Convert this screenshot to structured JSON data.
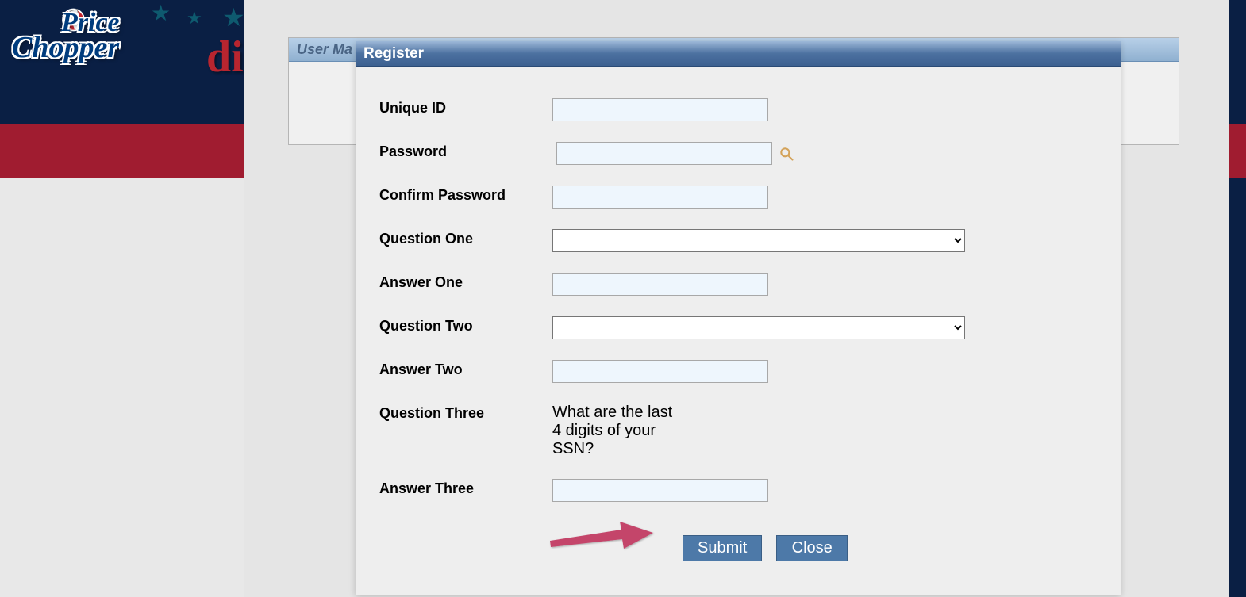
{
  "background": {
    "logo_price": "Price",
    "logo_chopper": "Chopper",
    "logo_partial": "di",
    "user_panel_title": "User Ma"
  },
  "modal": {
    "title": "Register",
    "fields": {
      "unique_id": {
        "label": "Unique ID",
        "value": ""
      },
      "password": {
        "label": "Password",
        "value": ""
      },
      "confirm_password": {
        "label": "Confirm Password",
        "value": ""
      },
      "question_one": {
        "label": "Question One",
        "value": ""
      },
      "answer_one": {
        "label": "Answer One",
        "value": ""
      },
      "question_two": {
        "label": "Question Two",
        "value": ""
      },
      "answer_two": {
        "label": "Answer Two",
        "value": ""
      },
      "question_three": {
        "label": "Question Three",
        "text": "What are the last 4 digits of your SSN?"
      },
      "answer_three": {
        "label": "Answer Three",
        "value": ""
      }
    },
    "buttons": {
      "submit": "Submit",
      "close": "Close"
    }
  }
}
